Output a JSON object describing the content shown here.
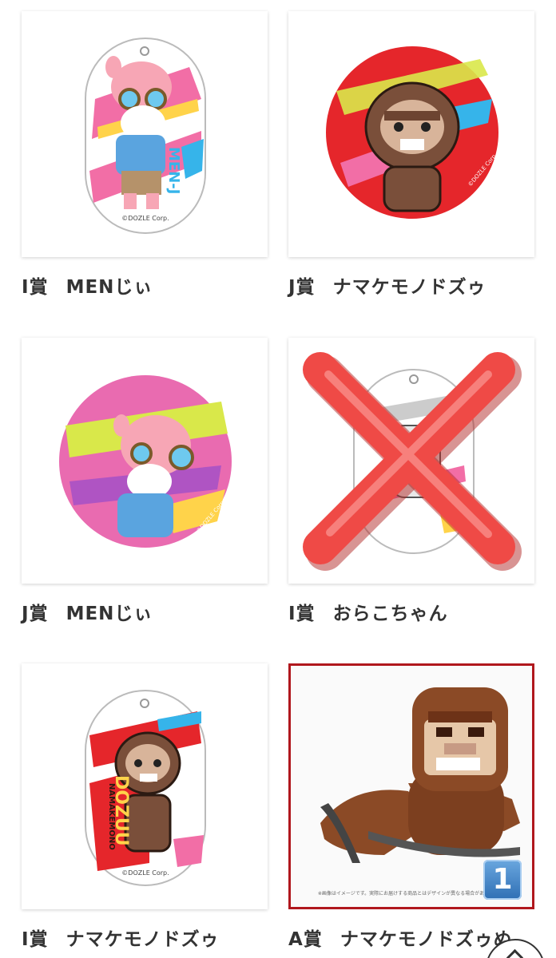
{
  "items": [
    {
      "prize": "I賞",
      "name": "MENじぃ",
      "image": "menjii-plate-icon"
    },
    {
      "prize": "J賞",
      "name": "ナマケモノドズゥ",
      "image": "dozuu-badge-icon"
    },
    {
      "prize": "J賞",
      "name": "MENじぃ",
      "image": "menjii-badge-icon"
    },
    {
      "prize": "I賞",
      "name": "おらこちゃん",
      "image": "orako-plate-crossed-icon"
    },
    {
      "prize": "I賞",
      "name": "ナマケモノドズゥ",
      "image": "dozuu-plate-icon"
    },
    {
      "prize": "A賞",
      "name": "ナマケモノドズゥぬ",
      "image": "dozuu-plush-icon"
    }
  ],
  "plate_texts": {
    "menjii": "MEN-J",
    "dozuu_small": "NAMAKEMONO",
    "dozuu_big": "DOZUU",
    "copyright": "©DOZLE Corp."
  },
  "plush_note": "※画像はイメージです。実際にお届けする商品とはデザインが異なる場合があります",
  "badge_number": "1",
  "colors": {
    "selected_border": "#b0171d",
    "cross_red": "#ef4a46",
    "badge_blue": "#3d7fc4"
  }
}
